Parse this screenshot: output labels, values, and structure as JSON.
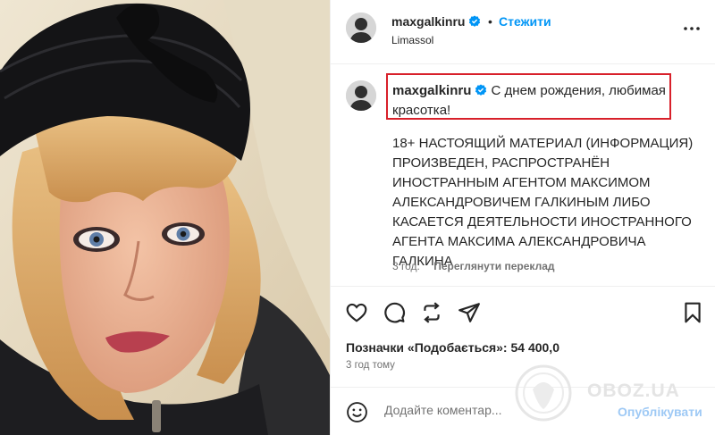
{
  "header": {
    "username": "maxgalkinru",
    "separator": "•",
    "follow_label": "Стежити",
    "location": "Limassol"
  },
  "caption": {
    "username": "maxgalkinru",
    "text": "С днем рождения, любимая красотка!",
    "disclaimer": "18+ НАСТОЯЩИЙ МАТЕРИАЛ (ИНФОРМАЦИЯ) ПРОИЗВЕДЕН, РАСПРОСТРАНЁН ИНОСТРАННЫМ АГЕНТОМ МАКСИМОМ АЛЕКСАНДРОВИЧЕМ ГАЛКИНЫМ ЛИБО КАСАЕТСЯ ДЕЯТЕЛЬНОСТИ ИНОСТРАННОГО АГЕНТА МАКСИМА АЛЕКСАНДРОВИЧА ГАЛКИНА",
    "age": "3 год.",
    "translate_label": "Переглянути переклад"
  },
  "actions": {
    "like_icon": "heart-icon",
    "comment_icon": "comment-icon",
    "share_icon": "repost-icon",
    "send_icon": "send-icon",
    "save_icon": "bookmark-icon"
  },
  "likes_text": "Позначки «Подобається»: 54 400,0",
  "posted_ago": "3 год тому",
  "comment": {
    "placeholder": "Додайте коментар...",
    "publish_label": "Опублікувати"
  },
  "watermark": "OBOZ.UA",
  "colors": {
    "accent": "#0095f6",
    "verified": "#0095f6",
    "highlight_border": "#d8202a",
    "muted": "#737373",
    "publish_disabled": "#9ec9f5"
  }
}
